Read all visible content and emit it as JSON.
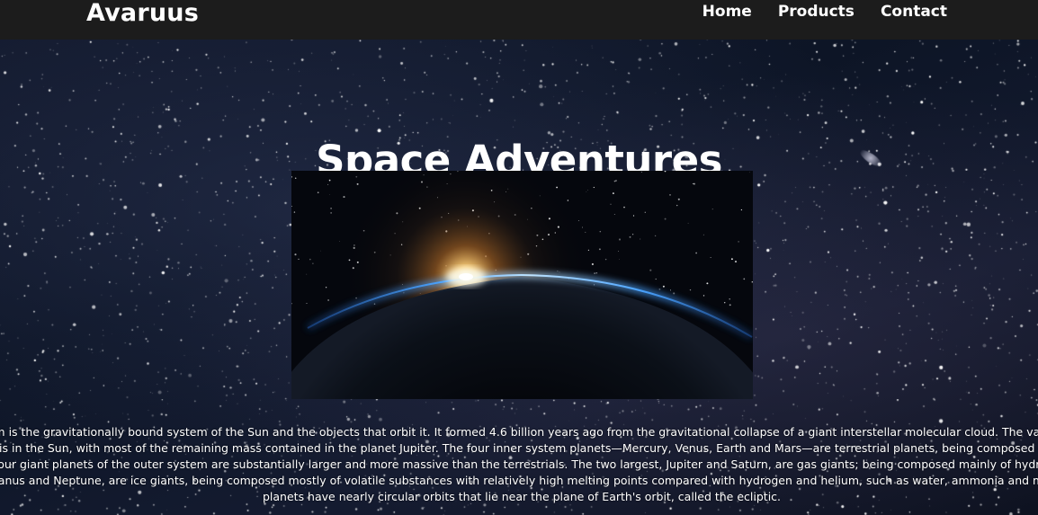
{
  "nav": {
    "brand": "Avaruus",
    "links": [
      {
        "label": "Home"
      },
      {
        "label": "Products"
      },
      {
        "label": "Contact"
      }
    ]
  },
  "hero": {
    "title": "Space Adventures",
    "image_icon": "earth-sunrise-image",
    "description": "The Solar System is the gravitationally bound system of the Sun and the objects that orbit it. It formed 4.6 billion years ago from the gravitational collapse of a giant interstellar molecular cloud. The vast majority of the system's mass is in the Sun, with most of the remaining mass contained in the planet Jupiter. The four inner system planets—Mercury, Venus, Earth and Mars—are terrestrial planets, being composed primarily of rock and metal. The four giant planets of the outer system are substantially larger and more massive than the terrestrials. The two largest, Jupiter and Saturn, are gas giants; being composed mainly of hydrogen and helium; the next two, Uranus and Neptune, are ice giants, being composed mostly of volatile substances with relatively high melting points compared with hydrogen and helium, such as water, ammonia and methane. All eight planets have nearly circular orbits that lie near the plane of Earth's orbit, called the ecliptic."
  },
  "colors": {
    "navbar_bg": "#1c1c1c",
    "text": "#ffffff",
    "sky": "#0d1526",
    "atmosphere_glow": "#3d8bff",
    "sun_glow": "#ffb347"
  }
}
